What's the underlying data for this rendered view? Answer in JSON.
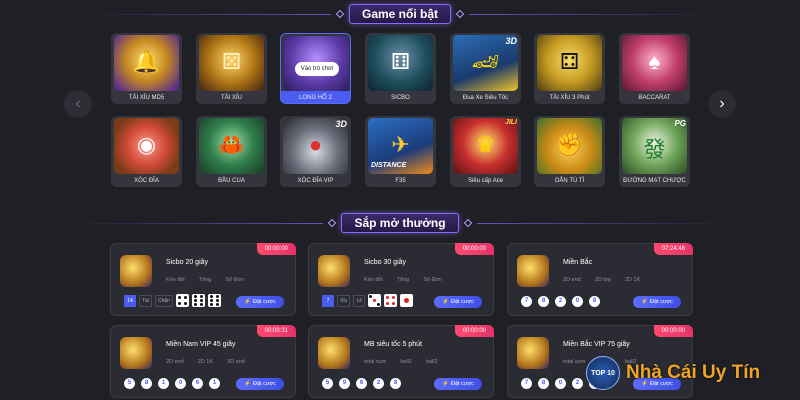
{
  "sections": {
    "featured_title": "Game nổi bật",
    "upcoming_title": "Sắp mở thưởng"
  },
  "games": [
    {
      "name": "TÀI XỈU MD5",
      "icon": "gold-bell-dice-icon"
    },
    {
      "name": "TÀI XỈU",
      "icon": "gold-dice-icon"
    },
    {
      "name": "LONG HỔ 2",
      "icon": "dragon-tiger-icon",
      "active": true,
      "play": "Vào trò chơi"
    },
    {
      "name": "SICBO",
      "icon": "sicbo-cup-icon"
    },
    {
      "name": "Đua Xe Siêu Tốc",
      "icon": "race-car-icon",
      "badge": "3D"
    },
    {
      "name": "TÀI XỈU 3 Phút",
      "icon": "black-cup-dice-icon"
    },
    {
      "name": "BACCARAT",
      "icon": "baccarat-character-icon"
    },
    {
      "name": "XÓC ĐĨA",
      "icon": "xoc-dia-plate-icon"
    },
    {
      "name": "BẦU CUA",
      "icon": "bau-cua-dice-icon"
    },
    {
      "name": "XÓC ĐĨA VIP",
      "icon": "glass-plate-icon",
      "badge": "3D"
    },
    {
      "name": "F35",
      "icon": "jet-fighter-icon",
      "banner": "DISTANCE"
    },
    {
      "name": "Siêu cấp Ace",
      "icon": "jester-hat-icon",
      "badge": "JILI"
    },
    {
      "name": "OẲN TÙ TÌ",
      "icon": "gold-coins-icon"
    },
    {
      "name": "ĐƯỜNG MẠT CHƯỢC",
      "icon": "mahjong-tile-icon",
      "badge": "PG"
    }
  ],
  "cards": [
    {
      "title": "Sicbo 20 giây",
      "timer": "00:00:00",
      "subs": [
        "Kéo đôi",
        "Tổng",
        "Số Đơn"
      ],
      "type": "sicbo",
      "chips": [
        "14",
        "Tài",
        "Chẵn"
      ],
      "dice": [
        4,
        6,
        6
      ],
      "bet": "Đặt cược"
    },
    {
      "title": "Sicbo 30 giây",
      "timer": "00:00:00",
      "subs": [
        "Kéo đôi",
        "Tổng",
        "Số Đơn"
      ],
      "type": "sicbo",
      "chips": [
        "7",
        "Xỉu",
        "Lẻ"
      ],
      "dice": [
        3,
        4,
        1
      ],
      "bet": "Đặt cược"
    },
    {
      "title": "Miền Bắc",
      "timer": "07:24:46",
      "subs": [
        "2D end",
        "2D top",
        "2D 1K"
      ],
      "type": "balls",
      "balls": [
        "7",
        "8",
        "2",
        "0",
        "8"
      ],
      "bet": "Đặt cược"
    },
    {
      "title": "Miền Nam VIP 45 giây",
      "timer": "00:00:31",
      "subs": [
        "2D end",
        "2D 1K",
        "3D end"
      ],
      "type": "balls",
      "balls": [
        "5",
        "8",
        "1",
        "0",
        "6",
        "1"
      ],
      "bet": "Đặt cược"
    },
    {
      "title": "MB siêu tốc 5 phút",
      "timer": "00:00:00",
      "subs": [
        "total sum",
        "ball1",
        "ball2"
      ],
      "type": "balls",
      "balls": [
        "5",
        "9",
        "6",
        "2",
        "8"
      ],
      "bet": "Đặt cược"
    },
    {
      "title": "Miền Bắc VIP 75 giây",
      "timer": "00:00:00",
      "subs": [
        "total sum",
        "ball1",
        "ball2"
      ],
      "type": "balls",
      "balls": [
        "7",
        "8",
        "0",
        "2",
        "8"
      ],
      "bet": "Đặt cược"
    }
  ],
  "watermark": {
    "logo_text": "TOP 10",
    "text": "Nhà Cái Uy Tín"
  },
  "colors": {
    "accent": "#4b5cf0",
    "timer": "#ff4a6e",
    "background": "#1f2026",
    "card": "#2b2c33",
    "gold": "#f0a526"
  }
}
